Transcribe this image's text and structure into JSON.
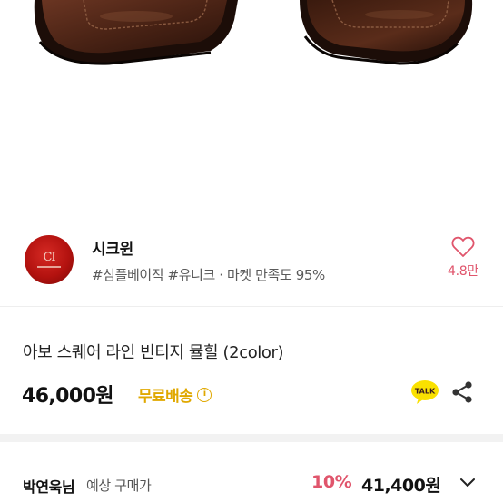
{
  "shop": {
    "name": "시크윈",
    "tags": "#심플베이직 #유니크 · 마켓 만족도 95%",
    "likes": "4.8만",
    "logo_text": "CI"
  },
  "product": {
    "title": "아보 스퀘어 라인 빈티지 뮬힐 (2color)",
    "price": "46,000원",
    "shipping": "무료배송",
    "info_icon": "i",
    "talk_label": "TALK"
  },
  "buyer_price": {
    "name": "박연욱님",
    "label": "예상 구매가",
    "discount": "10%",
    "price": "41,400원"
  },
  "icons": {
    "like": "heart-outline-icon",
    "share": "share-icon",
    "talk": "kakaotalk-icon",
    "expand": "chevron-down-icon",
    "info": "info-circle-icon"
  },
  "colors": {
    "accent_pink": "#e0556c",
    "shipping_yellow": "#e0a800",
    "kakao_yellow": "#fae100",
    "shoe_brown": "#4a2315"
  }
}
